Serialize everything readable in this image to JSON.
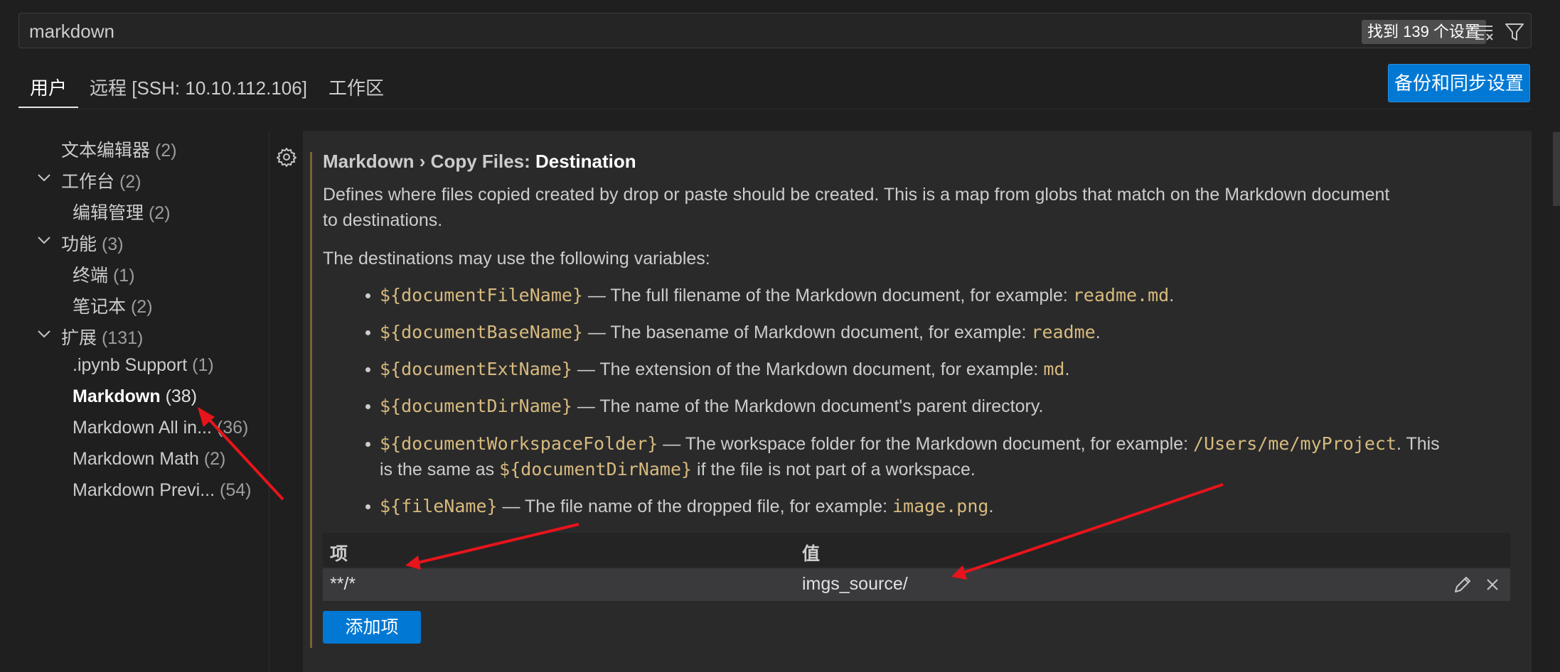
{
  "search": {
    "value": "markdown",
    "result_count": "找到 139 个设置"
  },
  "tabs": [
    {
      "label": "用户"
    },
    {
      "label": "远程 [SSH: 10.10.112.106]"
    },
    {
      "label": "工作区"
    }
  ],
  "sync_button": "备份和同步设置",
  "toc": [
    {
      "label": "文本编辑器",
      "count": "(2)"
    },
    {
      "label": "工作台",
      "count": "(2)"
    },
    {
      "label": "编辑管理",
      "count": "(2)"
    },
    {
      "label": "功能",
      "count": "(3)"
    },
    {
      "label": "终端",
      "count": "(1)"
    },
    {
      "label": "笔记本",
      "count": "(2)"
    },
    {
      "label": "扩展",
      "count": "(131)"
    },
    {
      "label": ".ipynb Support",
      "count": "(1)"
    },
    {
      "label": "Markdown",
      "count": "(38)"
    },
    {
      "label": "Markdown All in...",
      "count": "(36)"
    },
    {
      "label": "Markdown Math",
      "count": "(2)"
    },
    {
      "label": "Markdown Previ...",
      "count": "(54)"
    }
  ],
  "setting": {
    "title_prefix": "Markdown › Copy Files: ",
    "title_leaf": "Destination",
    "desc_line1": "Defines where files copied created by drop or paste should be created. This is a map from globs that match on the Markdown document",
    "desc_line2": "to destinations.",
    "vars_intro": "The destinations may use the following variables:",
    "variables": [
      {
        "name": "${documentFileName}",
        "text": " — The full filename of the Markdown document, for example: ",
        "example": "readme.md",
        "end": "."
      },
      {
        "name": "${documentBaseName}",
        "text": " — The basename of Markdown document, for example: ",
        "example": "readme",
        "end": "."
      },
      {
        "name": "${documentExtName}",
        "text": " — The extension of the Markdown document, for example: ",
        "example": "md",
        "end": "."
      },
      {
        "name": "${documentDirName}",
        "text": " — The name of the Markdown document's parent directory.",
        "example": "",
        "end": ""
      },
      {
        "name": "${documentWorkspaceFolder}",
        "text": " — The workspace folder for the Markdown document, for example: ",
        "example": "/Users/me/myProject",
        "end": ". This"
      },
      {
        "name": "${fileName}",
        "text": " — The file name of the dropped file, for example: ",
        "example": "image.png",
        "end": "."
      }
    ],
    "wrap_line": {
      "before": "is the same as ",
      "var": "${documentDirName}",
      "after": " if the file is not part of a workspace."
    }
  },
  "table": {
    "col_key": "项",
    "col_value": "值",
    "rows": [
      {
        "key": "**/*",
        "value": "imgs_source/"
      }
    ]
  },
  "add_button": "添加项",
  "colors": {
    "accent": "#0078d4",
    "variable": "#d7ba7d",
    "arrow": "#e8141b"
  }
}
